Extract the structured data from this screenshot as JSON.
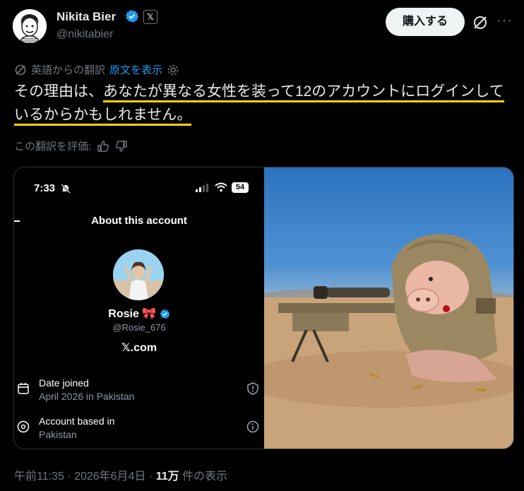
{
  "author": {
    "name": "Nikita Bier",
    "handle": "@nikitabier",
    "x_badge": "𝕏"
  },
  "header": {
    "buy_button": "購入する",
    "more_label": "···"
  },
  "translation": {
    "label": "英語からの翻訳",
    "link": "原文を表示"
  },
  "tweet": {
    "text_pre": "その理由は、",
    "text_highlight_1": "あなたが異なる女性を装って12のアカウントにログインして",
    "text_highlight_2": "いるからかもしれません。"
  },
  "rate": {
    "label": "この翻訳を評価:"
  },
  "embedded": {
    "time": "7:33",
    "battery": "54",
    "title": "About this account",
    "profile_name": "Rosie 🎀",
    "profile_handle": "@Rosie_676",
    "site": "𝕏.com",
    "date_joined_label": "Date joined",
    "date_joined_value": "April 2026 in Pakistan",
    "based_in_label": "Account based in",
    "based_in_value": "Pakistan"
  },
  "footer": {
    "time": "午前11:35 · 2026年6月4日 · ",
    "views": "11万",
    "views_suffix": " 件の表示"
  },
  "colors": {
    "accent": "#1d9bf0",
    "highlight": "#ffd400",
    "background": "#000000"
  }
}
